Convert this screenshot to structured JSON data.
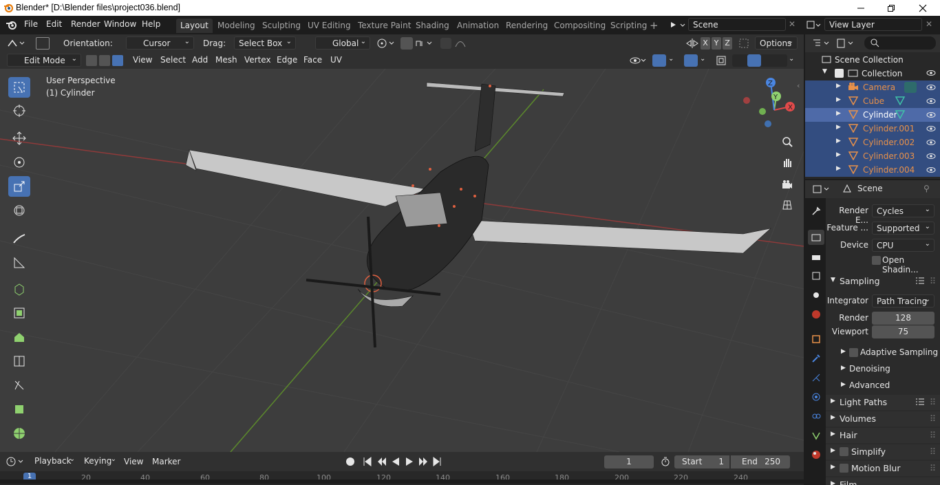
{
  "window": {
    "title": "Blender* [D:\\Blender files\\project036.blend]"
  },
  "menu": [
    "File",
    "Edit",
    "Render",
    "Window",
    "Help"
  ],
  "workspaces": [
    "Layout",
    "Modeling",
    "Sculpting",
    "UV Editing",
    "Texture Paint",
    "Shading",
    "Animation",
    "Rendering",
    "Compositing",
    "Scripting"
  ],
  "scene_field": "Scene",
  "viewlayer_field": "View Layer",
  "toolheader": {
    "orientation_label": "Orientation:",
    "orientation_value": "Cursor",
    "drag_label": "Drag:",
    "drag_value": "Select Box",
    "transform_orientation": "Global",
    "options": "Options"
  },
  "viewport_header": {
    "mode": "Edit Mode",
    "menus": [
      "View",
      "Select",
      "Add",
      "Mesh",
      "Vertex",
      "Edge",
      "Face",
      "UV"
    ]
  },
  "viewport": {
    "perspective": "User Perspective",
    "object": "(1) Cylinder",
    "gizmo": {
      "x": "X",
      "y": "Y",
      "z": "Z"
    }
  },
  "mirror_axes": [
    "X",
    "Y",
    "Z"
  ],
  "outliner": {
    "root": "Scene Collection",
    "collection": "Collection",
    "items": [
      {
        "name": "Camera",
        "type": "camera",
        "selected": true
      },
      {
        "name": "Cube",
        "type": "mesh",
        "selected": true
      },
      {
        "name": "Cylinder",
        "type": "mesh",
        "active": true
      },
      {
        "name": "Cylinder.001",
        "type": "mesh",
        "selected": true
      },
      {
        "name": "Cylinder.002",
        "type": "mesh",
        "selected": true
      },
      {
        "name": "Cylinder.003",
        "type": "mesh",
        "selected": true
      },
      {
        "name": "Cylinder.004",
        "type": "mesh",
        "selected": true
      }
    ]
  },
  "properties": {
    "context": "Scene",
    "render_engine_label": "Render E...",
    "render_engine": "Cycles",
    "feature_label": "Feature ...",
    "feature_set": "Supported",
    "device_label": "Device",
    "device": "CPU",
    "open_shading": "Open Shadin...",
    "sampling": "Sampling",
    "integrator_label": "Integrator",
    "integrator": "Path Tracing",
    "render_label": "Render",
    "render_samples": "128",
    "viewport_label": "Viewport",
    "viewport_samples": "75",
    "adaptive": "Adaptive Sampling",
    "denoising": "Denoising",
    "advanced": "Advanced",
    "light_paths": "Light Paths",
    "volumes": "Volumes",
    "hair": "Hair",
    "simplify": "Simplify",
    "motion_blur": "Motion Blur",
    "film": "Film"
  },
  "timeline": {
    "menus": [
      "Playback",
      "Keying",
      "View",
      "Marker"
    ],
    "current_frame": "1",
    "start_label": "Start",
    "start": "1",
    "end_label": "End",
    "end": "250",
    "ruler": [
      "1",
      "20",
      "40",
      "60",
      "80",
      "100",
      "120",
      "140",
      "160",
      "180",
      "200",
      "220",
      "240"
    ]
  },
  "colors": {
    "accent": "#4772b3",
    "selected_row": "#334d80",
    "active_row": "#4e6aa8",
    "object_orange": "#e8914a",
    "viewport_bg": "#3d3d3d"
  }
}
